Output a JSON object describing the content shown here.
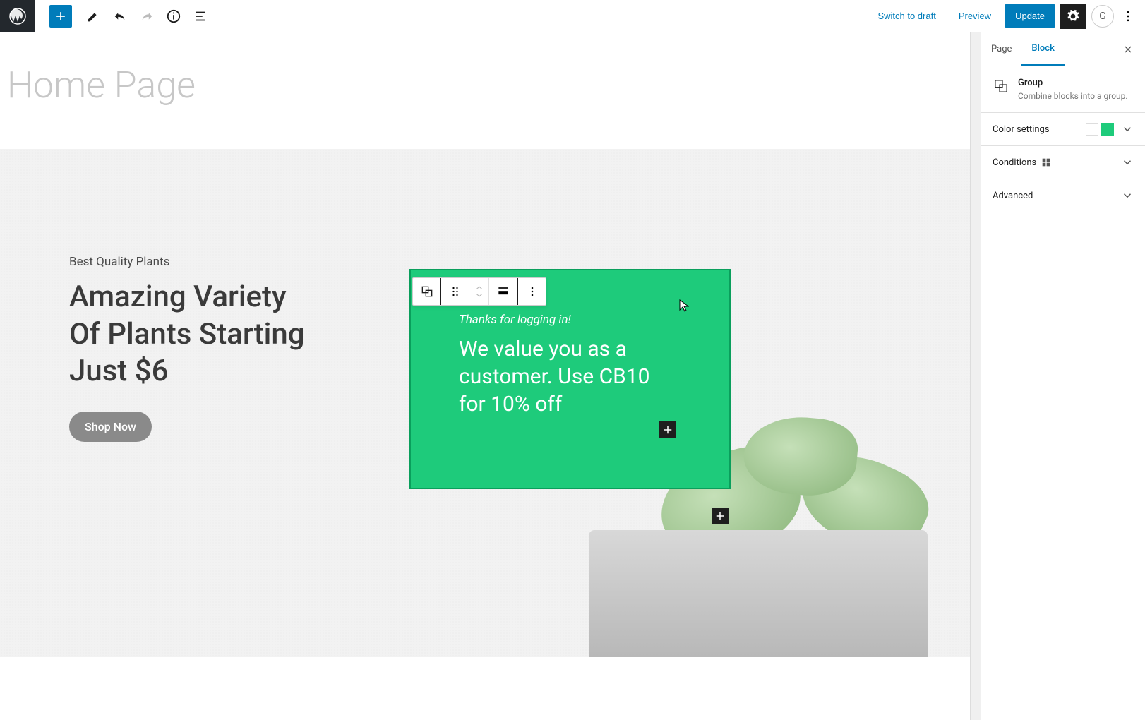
{
  "topbar": {
    "switch_draft": "Switch to draft",
    "preview": "Preview",
    "update": "Update",
    "account_initial": "G"
  },
  "page": {
    "title": "Home Page"
  },
  "hero": {
    "eyebrow": "Best Quality Plants",
    "headline_l1": "Amazing Variety",
    "headline_l2": "Of Plants Starting",
    "headline_l3": "Just $6",
    "cta": "Shop Now"
  },
  "green_block": {
    "thanks": "Thanks for logging in!",
    "promo": "We value you as a customer. Use CB10 for 10% off"
  },
  "sidebar": {
    "tabs": {
      "page": "Page",
      "block": "Block"
    },
    "block_info": {
      "title": "Group",
      "desc": "Combine blocks into a group."
    },
    "rows": {
      "color": "Color settings",
      "conditions": "Conditions",
      "advanced": "Advanced"
    }
  },
  "colors": {
    "accent": "#007cba",
    "block_bg": "#1ecb7b"
  }
}
